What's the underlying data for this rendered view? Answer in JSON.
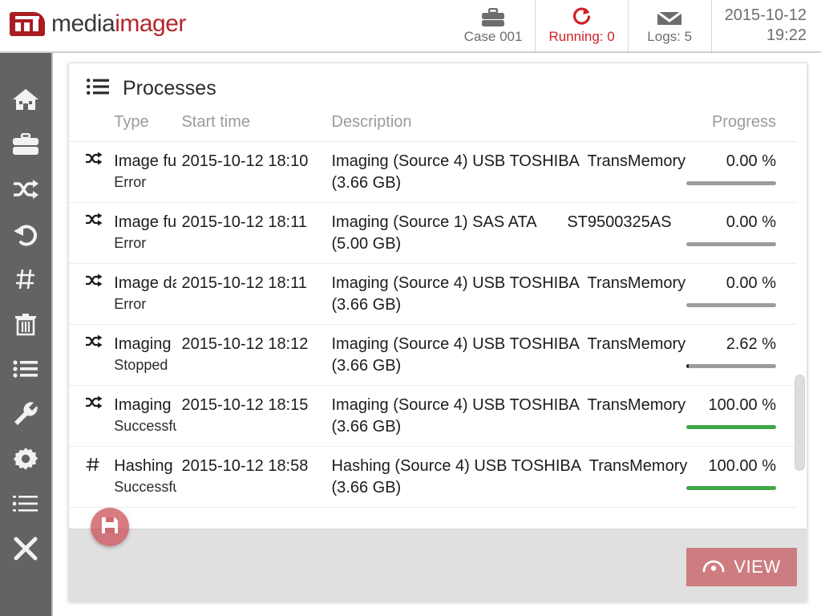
{
  "app": {
    "brand_first": "media",
    "brand_second": "imager",
    "logo_icon": "mediaimager-logo-icon",
    "accent_red": "#b3272d",
    "accent_green": "#3fa845",
    "sidebar_bg": "#636363"
  },
  "header": {
    "status": [
      {
        "icon": "briefcase-icon",
        "label": "Case 001"
      },
      {
        "icon": "running-refresh-icon",
        "label": "Running: 0"
      },
      {
        "icon": "envelope-icon",
        "label": "Logs: 5"
      }
    ],
    "datetime": {
      "date": "2015-10-12",
      "time": "19:22"
    }
  },
  "sidebar": {
    "items": [
      {
        "icon": "home-icon",
        "name": "sidebar-item-home"
      },
      {
        "icon": "briefcase-icon",
        "name": "sidebar-item-case"
      },
      {
        "icon": "shuffle-icon",
        "name": "sidebar-item-imaging"
      },
      {
        "icon": "undo-icon",
        "name": "sidebar-item-restore"
      },
      {
        "icon": "hash-icon",
        "name": "sidebar-item-hashing"
      },
      {
        "icon": "trash-icon",
        "name": "sidebar-item-wipe"
      },
      {
        "icon": "list-icon",
        "name": "sidebar-item-processes"
      },
      {
        "icon": "wrench-icon",
        "name": "sidebar-item-tools"
      },
      {
        "icon": "gear-icon",
        "name": "sidebar-item-settings"
      },
      {
        "icon": "list-indent-icon",
        "name": "sidebar-item-logs"
      },
      {
        "icon": "close-icon",
        "name": "sidebar-item-exit"
      }
    ]
  },
  "panel": {
    "icon": "list-icon",
    "title": "Processes",
    "columns": {
      "type": "Type",
      "start_time": "Start time",
      "description": "Description",
      "progress": "Progress"
    },
    "rows": [
      {
        "icon": "shuffle-icon",
        "type": "Image full d",
        "status": "Error",
        "start_time": "2015-10-12 18:10",
        "desc_line1": "Imaging (Source 4) USB TOSHIBA  TransMemory",
        "desc_line2": "(3.66 GB)",
        "progress_text": "0.00 %",
        "progress_value": 0,
        "bar_color": "#9c9c9c"
      },
      {
        "icon": "shuffle-icon",
        "type": "Image full d",
        "status": "Error",
        "start_time": "2015-10-12 18:11",
        "desc_line1": "Imaging (Source 1) SAS ATA       ST9500325AS",
        "desc_line2": "(5.00 GB)",
        "progress_text": "0.00 %",
        "progress_value": 0,
        "bar_color": "#9c9c9c"
      },
      {
        "icon": "shuffle-icon",
        "type": "Image data",
        "status": "Error",
        "start_time": "2015-10-12 18:11",
        "desc_line1": "Imaging (Source 4) USB TOSHIBA  TransMemory",
        "desc_line2": "(3.66 GB)",
        "progress_text": "0.00 %",
        "progress_value": 0,
        "bar_color": "#9c9c9c"
      },
      {
        "icon": "shuffle-icon",
        "type": "Imaging",
        "status": "Stopped",
        "start_time": "2015-10-12 18:12",
        "desc_line1": "Imaging (Source 4) USB TOSHIBA  TransMemory",
        "desc_line2": "(3.66 GB)",
        "progress_text": "2.62 %",
        "progress_value": 2.62,
        "bar_color": "#1c1c1c"
      },
      {
        "icon": "shuffle-icon",
        "type": "Imaging",
        "status": "Successful",
        "start_time": "2015-10-12 18:15",
        "desc_line1": "Imaging (Source 4) USB TOSHIBA  TransMemory",
        "desc_line2": "(3.66 GB)",
        "progress_text": "100.00 %",
        "progress_value": 100,
        "bar_color": "#3fa845"
      },
      {
        "icon": "hash-icon",
        "type": "Hashing",
        "status": "Successful",
        "start_time": "2015-10-12 18:58",
        "desc_line1": "Hashing (Source 4) USB TOSHIBA  TransMemory",
        "desc_line2": "(3.66 GB)",
        "progress_text": "100.00 %",
        "progress_value": 100,
        "bar_color": "#3fa845"
      }
    ],
    "footer": {
      "save_icon": "save-floppy-icon",
      "view_icon": "eye-icon",
      "view_label": "VIEW"
    }
  }
}
